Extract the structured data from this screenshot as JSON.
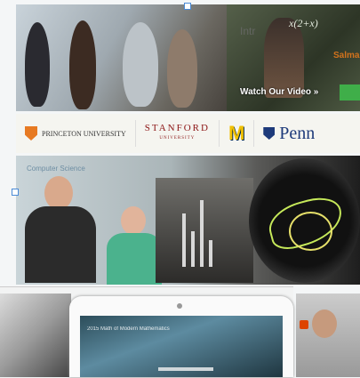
{
  "hero": {
    "heading": "Intr",
    "teacher_name": "Salma",
    "equation": "x(2+x)",
    "watch_label": "Watch Our Video »"
  },
  "logos": {
    "princeton": "PRINCETON UNIVERSITY",
    "stanford": "STANFORD",
    "stanford_sub": "UNIVERSITY",
    "michigan": "M",
    "penn": "Penn"
  },
  "course": {
    "category_label": "Computer Science"
  },
  "tablet": {
    "screen_title": "2015 Math of Modern Mathematics"
  }
}
